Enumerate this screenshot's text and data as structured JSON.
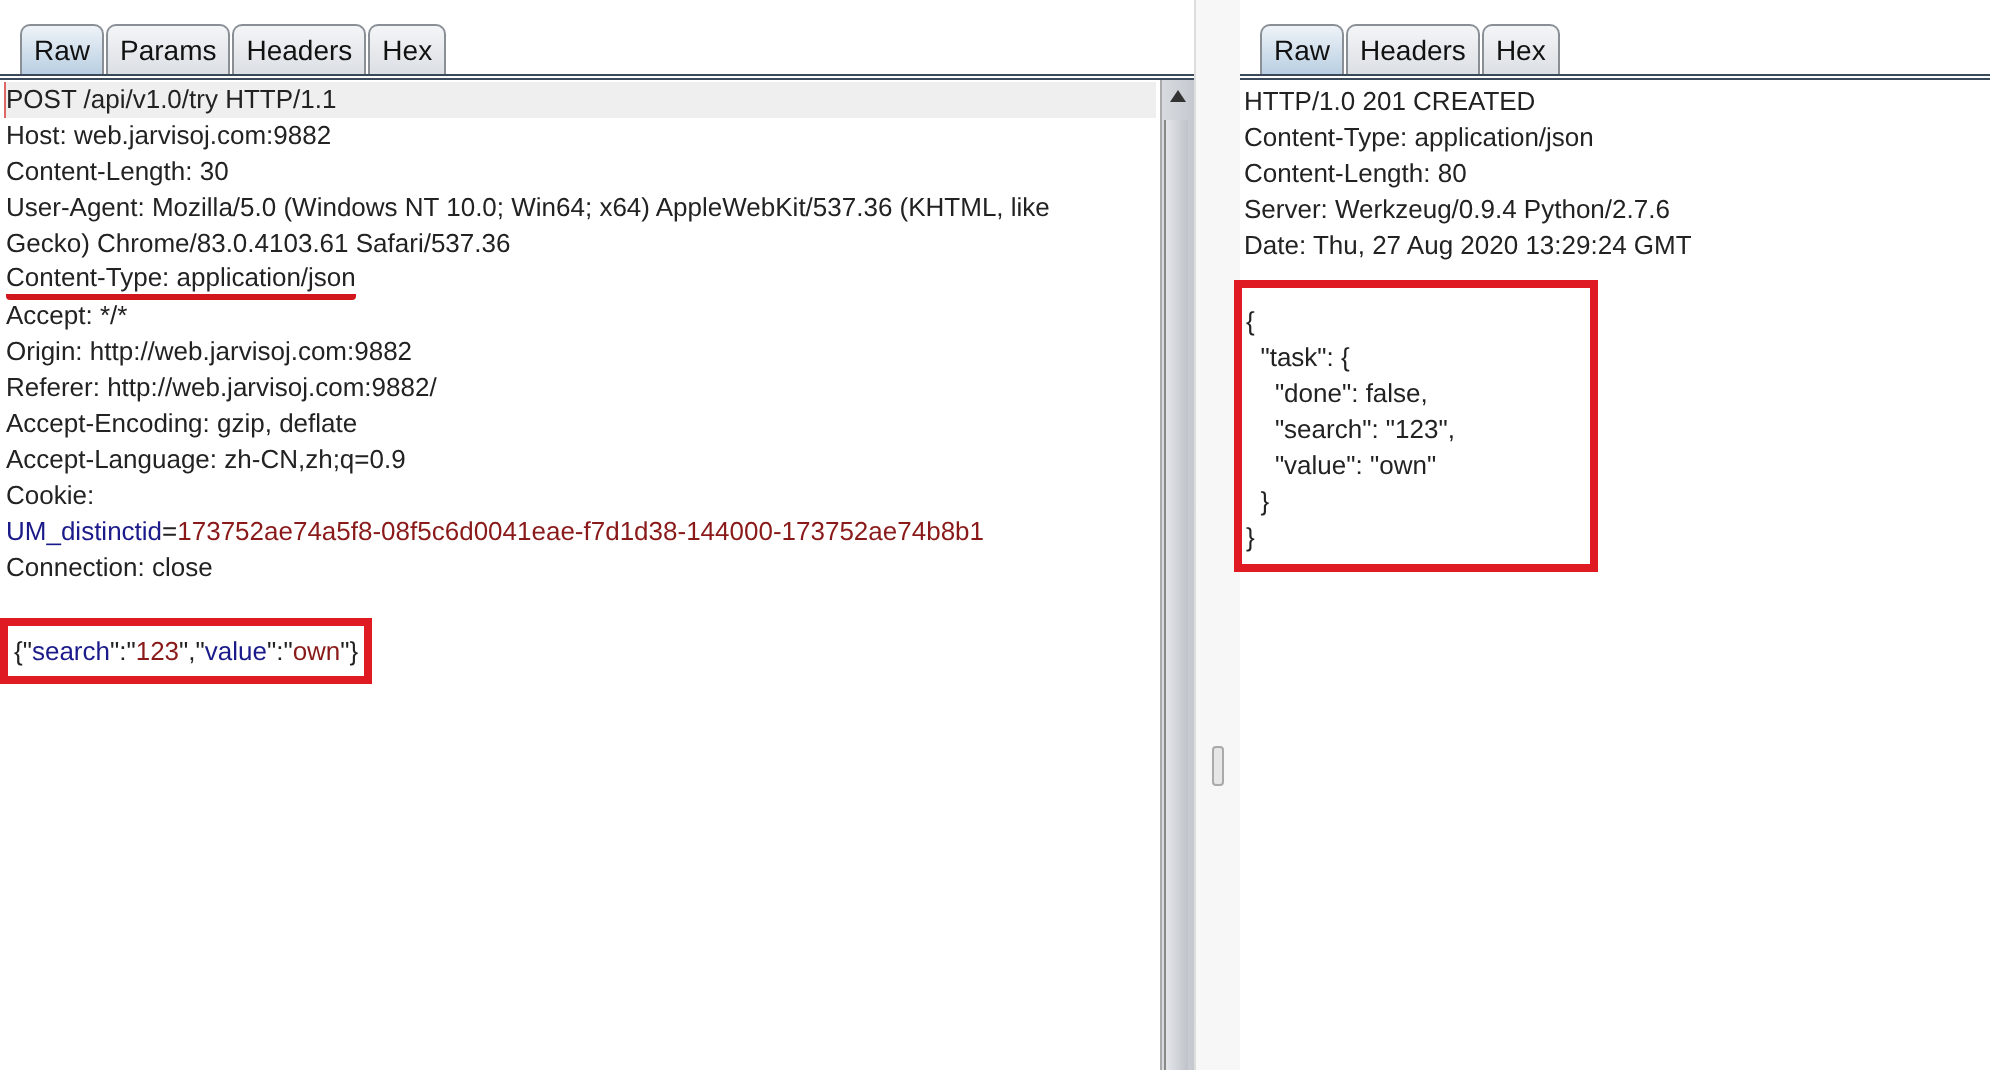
{
  "request": {
    "tabs": [
      {
        "label": "Raw",
        "selected": true
      },
      {
        "label": "Params",
        "selected": false
      },
      {
        "label": "Headers",
        "selected": false
      },
      {
        "label": "Hex",
        "selected": false
      }
    ],
    "lines": [
      {
        "current": true,
        "underlined": false,
        "parts": [
          {
            "text": "POST /api/v1.0/try HTTP/1.1",
            "kind": "plain"
          }
        ]
      },
      {
        "current": false,
        "underlined": false,
        "parts": [
          {
            "text": "Host: web.jarvisoj.com:9882",
            "kind": "plain"
          }
        ]
      },
      {
        "current": false,
        "underlined": false,
        "parts": [
          {
            "text": "Content-Length: 30",
            "kind": "plain"
          }
        ]
      },
      {
        "current": false,
        "underlined": false,
        "parts": [
          {
            "text": "User-Agent: Mozilla/5.0 (Windows NT 10.0; Win64; x64) AppleWebKit/537.36 (KHTML, like Gecko) Chrome/83.0.4103.61 Safari/537.36",
            "kind": "plain"
          }
        ]
      },
      {
        "current": false,
        "underlined": true,
        "parts": [
          {
            "text": "Content-Type: application/json",
            "kind": "plain"
          }
        ]
      },
      {
        "current": false,
        "underlined": false,
        "parts": [
          {
            "text": "Accept: */*",
            "kind": "plain"
          }
        ]
      },
      {
        "current": false,
        "underlined": false,
        "parts": [
          {
            "text": "Origin: http://web.jarvisoj.com:9882",
            "kind": "plain"
          }
        ]
      },
      {
        "current": false,
        "underlined": false,
        "parts": [
          {
            "text": "Referer: http://web.jarvisoj.com:9882/",
            "kind": "plain"
          }
        ]
      },
      {
        "current": false,
        "underlined": false,
        "parts": [
          {
            "text": "Accept-Encoding: gzip, deflate",
            "kind": "plain"
          }
        ]
      },
      {
        "current": false,
        "underlined": false,
        "parts": [
          {
            "text": "Accept-Language: zh-CN,zh;q=0.9",
            "kind": "plain"
          }
        ]
      },
      {
        "current": false,
        "underlined": false,
        "parts": [
          {
            "text": "Cookie:",
            "kind": "plain"
          }
        ]
      },
      {
        "current": false,
        "underlined": false,
        "parts": [
          {
            "text": "UM_distinctid",
            "kind": "name"
          },
          {
            "text": "=",
            "kind": "plain"
          },
          {
            "text": "173752ae74a5f8-08f5c6d0041eae-f7d1d38-144000-173752ae74b8b1",
            "kind": "value"
          }
        ]
      },
      {
        "current": false,
        "underlined": false,
        "parts": [
          {
            "text": "Connection: close",
            "kind": "plain"
          }
        ]
      }
    ],
    "body": {
      "boxed": true,
      "lines": [
        {
          "parts": [
            {
              "text": "{\"",
              "kind": "plain"
            },
            {
              "text": "search",
              "kind": "name"
            },
            {
              "text": "\":\"",
              "kind": "plain"
            },
            {
              "text": "123",
              "kind": "value"
            },
            {
              "text": "\",\"",
              "kind": "plain"
            },
            {
              "text": "value",
              "kind": "name"
            },
            {
              "text": "\":\"",
              "kind": "plain"
            },
            {
              "text": "own",
              "kind": "value"
            },
            {
              "text": "\"}",
              "kind": "plain"
            }
          ]
        }
      ]
    }
  },
  "response": {
    "tabs": [
      {
        "label": "Raw",
        "selected": true
      },
      {
        "label": "Headers",
        "selected": false
      },
      {
        "label": "Hex",
        "selected": false
      }
    ],
    "lines": [
      "HTTP/1.0 201 CREATED",
      "Content-Type: application/json",
      "Content-Length: 80",
      "Server: Werkzeug/0.9.4 Python/2.7.6",
      "Date: Thu, 27 Aug 2020 13:29:24 GMT"
    ],
    "body": {
      "boxed": true,
      "lines": [
        "{",
        "  \"task\": {",
        "    \"done\": false,",
        "    \"search\": \"123\",",
        "    \"value\": \"own\"",
        "  }",
        "}"
      ]
    }
  }
}
